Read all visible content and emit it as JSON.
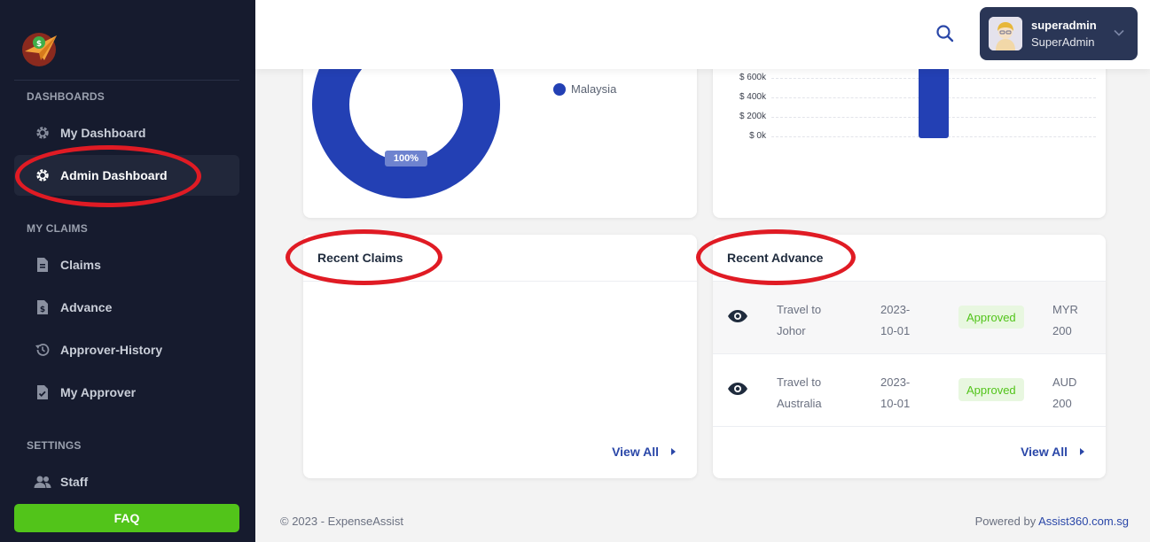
{
  "sidebar": {
    "sections": {
      "dashboards": "DASHBOARDS",
      "my_claims": "MY CLAIMS",
      "settings": "SETTINGS"
    },
    "items": [
      {
        "label": "My Dashboard",
        "icon": "gear-icon"
      },
      {
        "label": "Admin Dashboard",
        "icon": "gear-icon"
      },
      {
        "label": "Claims",
        "icon": "document-icon"
      },
      {
        "label": "Advance",
        "icon": "money-document-icon"
      },
      {
        "label": "Approver-History",
        "icon": "history-icon"
      },
      {
        "label": "My Approver",
        "icon": "approve-document-icon"
      },
      {
        "label": "Staff",
        "icon": "users-icon"
      }
    ],
    "faq_label": "FAQ"
  },
  "header": {
    "user_name": "superadmin",
    "user_role": "SuperAdmin"
  },
  "country_chart": {
    "chart_data": {
      "type": "pie",
      "categories": [
        "Malaysia"
      ],
      "values": [
        100
      ],
      "data_label": "100%",
      "colors": [
        "#2340b4"
      ]
    }
  },
  "bar_chart": {
    "chart_data": {
      "type": "bar",
      "y_tick_labels": [
        "$ 0k",
        "$ 200k",
        "$ 400k",
        "$ 600k"
      ],
      "ylim": [
        0,
        600000
      ],
      "bar_color": "#2340b4"
    }
  },
  "recent_claims": {
    "title": "Recent Claims",
    "view_all": "View All"
  },
  "recent_advance": {
    "title": "Recent Advance",
    "view_all": "View All",
    "rows": [
      {
        "desc_line1": "Travel to",
        "desc_line2": "Johor",
        "date_line1": "2023-",
        "date_line2": "10-01",
        "status": "Approved",
        "currency": "MYR",
        "amount": "200"
      },
      {
        "desc_line1": "Travel to",
        "desc_line2": "Australia",
        "date_line1": "2023-",
        "date_line2": "10-01",
        "status": "Approved",
        "currency": "AUD",
        "amount": "200"
      }
    ]
  },
  "footer": {
    "copyright": "© 2023 - ExpenseAssist",
    "powered_by": "Powered by",
    "powered_link": "Assist360.com.sg"
  },
  "colors": {
    "sidebar_bg": "#161b2e",
    "accent_blue": "#2340b4",
    "faq_green": "#52c41a",
    "annotation_red": "#e01b24"
  }
}
